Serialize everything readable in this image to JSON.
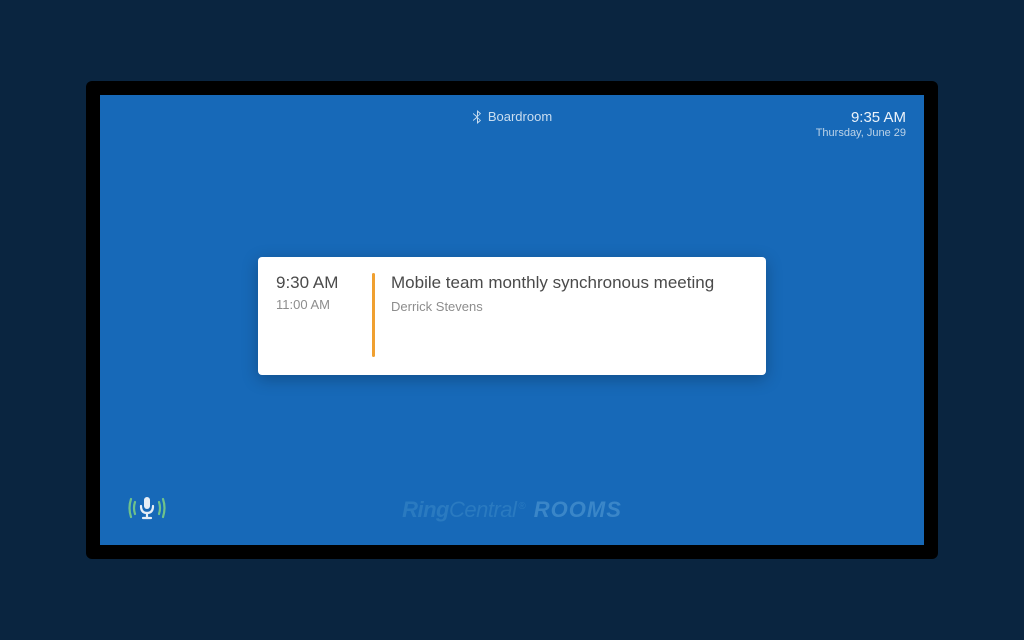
{
  "status": {
    "room_name": "Boardroom",
    "time": "9:35 AM",
    "date": "Thursday, June 29"
  },
  "meeting": {
    "start": "9:30 AM",
    "end": "11:00 AM",
    "title": "Mobile team monthly synchronous meeting",
    "organizer": "Derrick Stevens"
  },
  "brand": {
    "ring": "Ring",
    "central": "Central",
    "reg": "®",
    "rooms": "ROOMS"
  }
}
